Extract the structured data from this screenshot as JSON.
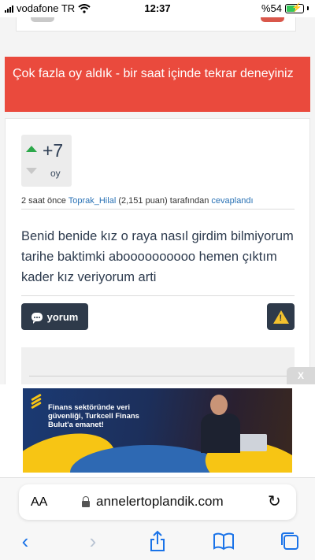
{
  "status_bar": {
    "carrier": "vodafone TR",
    "time": "12:37",
    "battery": "%54",
    "battery_level": 0.54
  },
  "alert": {
    "message": "Çok fazla oy aldık - bir saat içinde tekrar deneyiniz"
  },
  "answer": {
    "votes": "+7",
    "votes_label": "oy",
    "meta_prefix": "2 saat önce",
    "author": "Toprak_Hilal",
    "points": "(2,151 puan)",
    "meta_mid": "tarafından",
    "action": "cevaplandı",
    "text": "Benid benide  kız o raya nasıl girdim bilmiyorum tarihe baktimki aboooooooooo hemen çıktım kader  kız veriyorum arti",
    "comment_button": "yorum",
    "report_icon": "warning-icon"
  },
  "ad": {
    "close_label": "X",
    "text": "Finans sektöründe veri güvenliği, Turkcell Finans Bulut'a emanet!",
    "colors": {
      "yellow": "#f7c514",
      "navy": "#1b3a73"
    }
  },
  "browser": {
    "aa_label": "AA",
    "url": "annelertoplandik.com",
    "nav_icons": [
      "back-icon",
      "forward-icon",
      "share-icon",
      "bookmarks-icon",
      "tabs-icon"
    ]
  },
  "colors": {
    "alert_red": "#ea4a3d",
    "vote_green": "#2ca84a",
    "button_dark": "#2e3a4a",
    "link_blue": "#2a72b5",
    "ios_blue": "#1a73e8"
  }
}
